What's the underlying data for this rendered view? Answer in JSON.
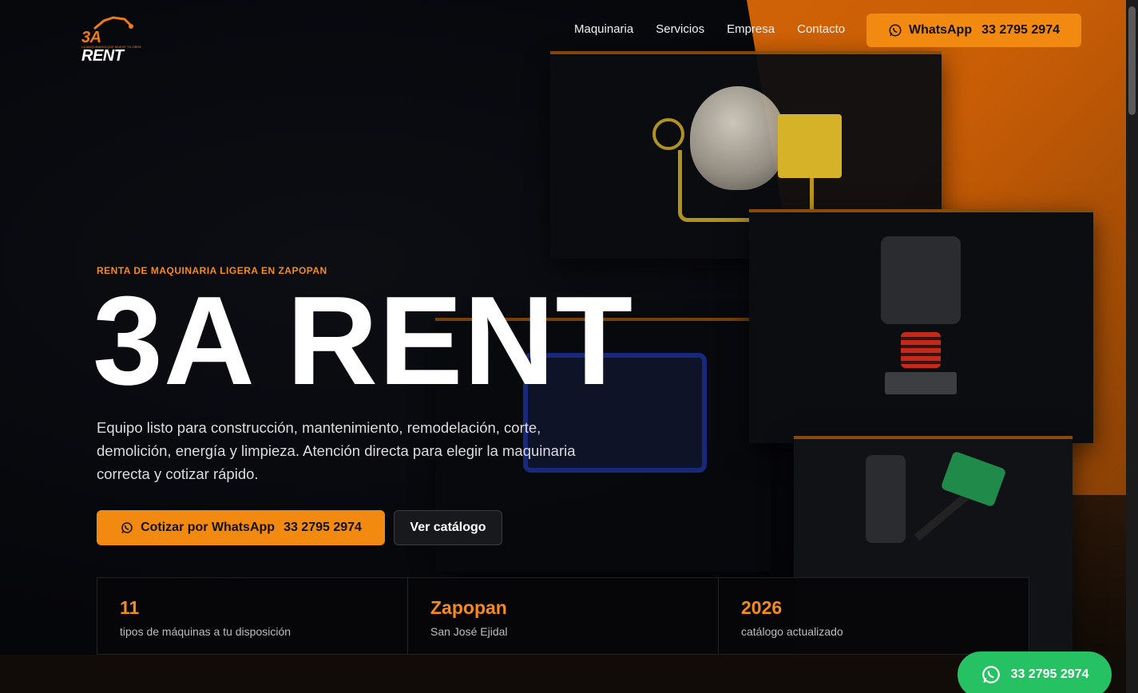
{
  "brand": {
    "logo_text_main": "3A",
    "logo_text_rest": " RENT",
    "logo_tagline": "LA MAQUINARIA QUE MUEVE TU OBRA"
  },
  "nav": {
    "items": [
      "Maquinaria",
      "Servicios",
      "Empresa",
      "Contacto"
    ],
    "whatsapp_label": "WhatsApp",
    "whatsapp_number": "33 2795 2974"
  },
  "hero": {
    "eyebrow": "RENTA DE MAQUINARIA LIGERA EN ZAPOPAN",
    "title": "3A RENT",
    "description": "Equipo listo para construcción, mantenimiento, remodelación, corte, demolición, energía y limpieza. Atención directa para elegir la maquinaria correcta y cotizar rápido.",
    "cta_primary_label": "Cotizar por WhatsApp",
    "cta_primary_number": "33 2795 2974",
    "cta_secondary_label": "Ver catálogo"
  },
  "stats": [
    {
      "value": "11",
      "label": "tipos de máquinas a tu disposición"
    },
    {
      "value": "Zapopan",
      "label": "San José Ejidal"
    },
    {
      "value": "2026",
      "label": "catálogo actualizado"
    }
  ],
  "floating_whatsapp": {
    "number": "33 2795 2974"
  },
  "colors": {
    "accent": "#f28a12",
    "background": "#06070a",
    "whatsapp_green": "#25c162"
  },
  "icons": {
    "whatsapp": "whatsapp-icon"
  }
}
